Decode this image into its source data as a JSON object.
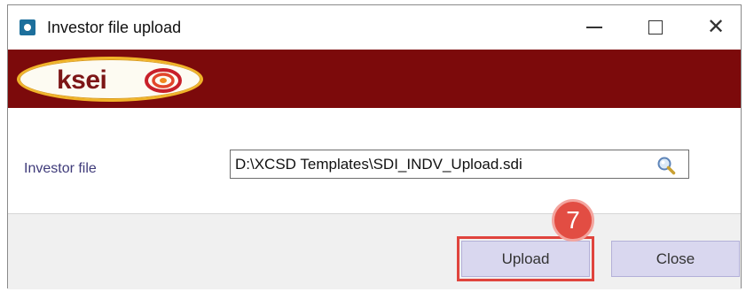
{
  "window": {
    "title": "Investor file upload",
    "icons": [
      "app-icon",
      "minimize-icon",
      "maximize-icon",
      "close-icon"
    ]
  },
  "banner": {
    "logo_text": "ksei",
    "background_color": "#7c0a0b",
    "logo_border_color": "#f0b429"
  },
  "form": {
    "investor_file_label": "Investor file",
    "investor_file_value": "D:\\XCSD Templates\\SDI_INDV_Upload.sdi",
    "browse_icon": "search-icon"
  },
  "footer": {
    "upload_label": "Upload",
    "close_label": "Close",
    "button_color": "#d9d7ef"
  },
  "annotation": {
    "step_number": "7",
    "highlight_color": "#e0443d"
  }
}
